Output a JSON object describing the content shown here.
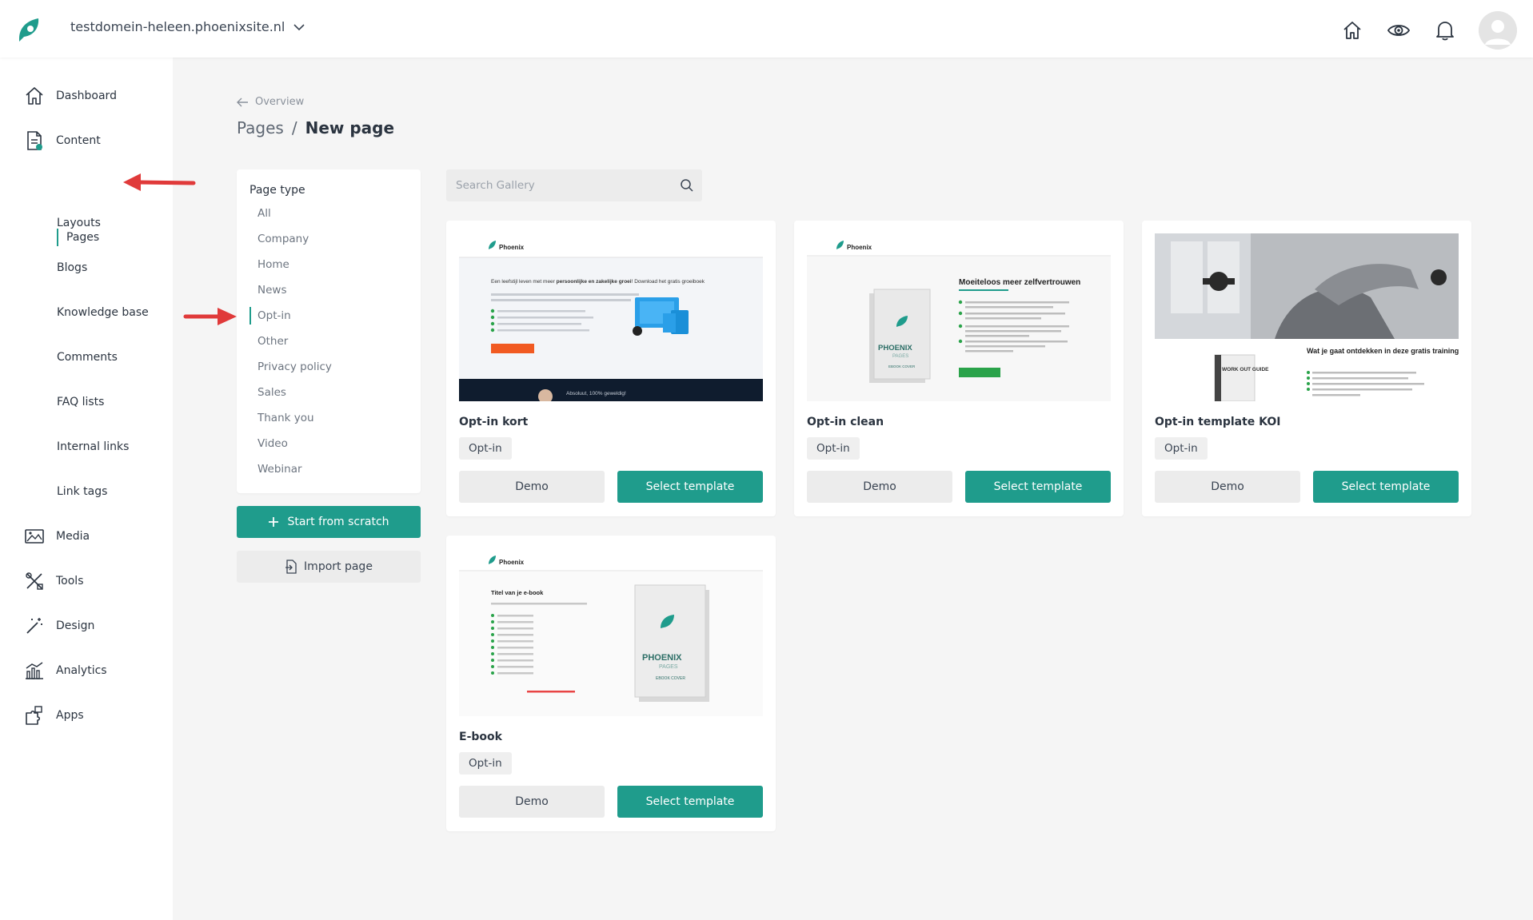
{
  "colors": {
    "accent": "#1f9c8c",
    "annotation_arrow": "#e03a3a"
  },
  "header": {
    "domain": "testdomein-heleen.phoenixsite.nl",
    "icons": [
      "home-icon",
      "eye-icon",
      "bell-icon",
      "user-avatar"
    ]
  },
  "sidebar": {
    "items": [
      {
        "label": "Dashboard",
        "icon": "home-icon"
      },
      {
        "label": "Content",
        "icon": "document-icon"
      },
      {
        "label": "Pages"
      },
      {
        "label": "Layouts"
      },
      {
        "label": "Blogs"
      },
      {
        "label": "Knowledge base"
      },
      {
        "label": "Comments"
      },
      {
        "label": "FAQ lists"
      },
      {
        "label": "Internal links"
      },
      {
        "label": "Link tags"
      },
      {
        "label": "Media",
        "icon": "image-icon"
      },
      {
        "label": "Tools",
        "icon": "tools-icon"
      },
      {
        "label": "Design",
        "icon": "magic-wand-icon"
      },
      {
        "label": "Analytics",
        "icon": "chart-icon"
      },
      {
        "label": "Apps",
        "icon": "puzzle-icon"
      }
    ]
  },
  "breadcrumb": {
    "back": "Overview",
    "parent": "Pages",
    "separator": "/",
    "current": "New page"
  },
  "filter": {
    "heading": "Page type",
    "options": [
      "All",
      "Company",
      "Home",
      "News",
      "Opt-in",
      "Other",
      "Privacy policy",
      "Sales",
      "Thank you",
      "Video",
      "Webinar"
    ],
    "active": "Opt-in"
  },
  "actions": {
    "scratch": "Start from scratch",
    "import": "Import page"
  },
  "search": {
    "placeholder": "Search Gallery",
    "value": ""
  },
  "templates": [
    {
      "title": "Opt-in kort",
      "tag": "Opt-in",
      "demo": "Demo",
      "select": "Select template",
      "preview": {
        "brand": "Phoenix",
        "headline_a": "Een leefstijl leven met meer ",
        "headline_b": "persoonlijke en zakelijke groei",
        "headline_c": "! Download het gratis groeiboek",
        "footer": "Absoluut, 100% geweldig!"
      }
    },
    {
      "title": "Opt-in clean",
      "tag": "Opt-in",
      "demo": "Demo",
      "select": "Select template",
      "preview": {
        "brand": "Phoenix",
        "headline": "Moeiteloos meer zelfvertrouwen",
        "book_title": "PHOENIX",
        "book_sub": "PAGES",
        "book_caption": "EBOOK COVER"
      }
    },
    {
      "title": "Opt-in template KOI",
      "tag": "Opt-in",
      "demo": "Demo",
      "select": "Select template",
      "preview": {
        "headline": "Wat je gaat ontdekken in deze gratis training",
        "book": "WORK OUT GUIDE"
      }
    },
    {
      "title": "E-book",
      "tag": "Opt-in",
      "demo": "Demo",
      "select": "Select template",
      "preview": {
        "brand": "Phoenix",
        "headline": "Titel van je e-book",
        "book_title": "PHOENIX",
        "book_sub": "PAGES",
        "book_caption": "EBOOK COVER"
      }
    }
  ]
}
